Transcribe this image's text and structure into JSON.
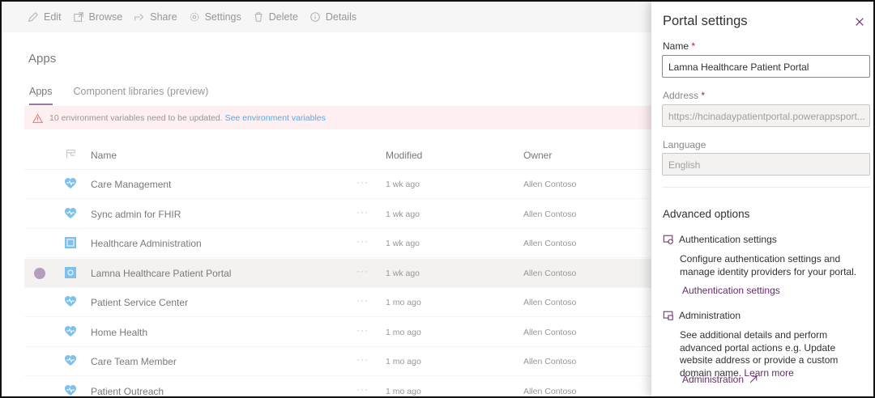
{
  "toolbar": {
    "edit": "Edit",
    "browse": "Browse",
    "share": "Share",
    "settings": "Settings",
    "delete": "Delete",
    "details": "Details"
  },
  "page": {
    "title": "Apps",
    "tabs": [
      "Apps",
      "Component libraries (preview)"
    ]
  },
  "banner": {
    "message": "10 environment variables need to be updated.",
    "link": "See environment variables"
  },
  "table": {
    "columns": {
      "name": "Name",
      "modified": "Modified",
      "owner": "Owner"
    },
    "more": "···",
    "rows": [
      {
        "name": "Care Management",
        "modified": "1 wk ago",
        "owner": "Allen Contoso",
        "icon": "heart-icon"
      },
      {
        "name": "Sync admin for FHIR",
        "modified": "1 wk ago",
        "owner": "Allen Contoso",
        "icon": "heart-icon"
      },
      {
        "name": "Healthcare Administration",
        "modified": "1 wk ago",
        "owner": "Allen Contoso",
        "icon": "app-tile-icon"
      },
      {
        "name": "Lamna Healthcare Patient Portal",
        "modified": "1 wk ago",
        "owner": "Allen Contoso",
        "icon": "portal-icon"
      },
      {
        "name": "Patient Service Center",
        "modified": "1 mo ago",
        "owner": "Allen Contoso",
        "icon": "heart-icon"
      },
      {
        "name": "Home Health",
        "modified": "1 mo ago",
        "owner": "Allen Contoso",
        "icon": "heart-icon"
      },
      {
        "name": "Care Team Member",
        "modified": "1 mo ago",
        "owner": "Allen Contoso",
        "icon": "heart-icon"
      },
      {
        "name": "Patient Outreach",
        "modified": "1 mo ago",
        "owner": "Allen Contoso",
        "icon": "heart-icon"
      }
    ]
  },
  "panel": {
    "title": "Portal settings",
    "name_label": "Name",
    "name_value": "Lamna Healthcare Patient Portal",
    "address_label": "Address",
    "address_value": "https://hcinadaypatientportal.powerappsport...",
    "language_label": "Language",
    "language_value": "English",
    "required_mark": "*",
    "advanced_title": "Advanced options",
    "auth_title": "Authentication settings",
    "auth_desc": "Configure authentication settings and manage identity providers for your portal.",
    "auth_link": "Authentication settings",
    "admin_title": "Administration",
    "admin_desc": "See additional details and perform advanced portal actions e.g. Update website address or provide a custom domain name.",
    "admin_learn_more": "Learn more",
    "admin_link": "Administration"
  },
  "colors": {
    "accent": "#6b2a6f",
    "banner_bg": "#fde7e9",
    "selected_row": "#edebe9",
    "app_icon": "#3aa0e0"
  }
}
